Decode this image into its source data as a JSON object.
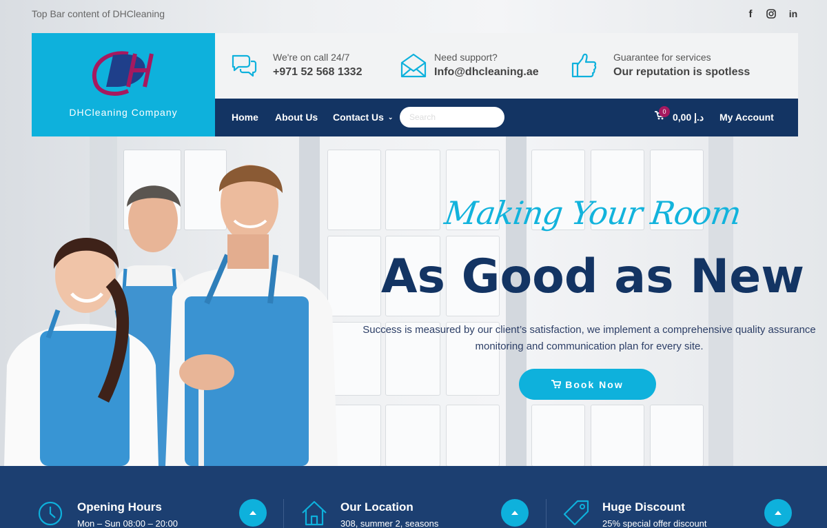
{
  "topbar": {
    "text": "Top Bar content of DHCleaning",
    "social": [
      {
        "icon": "facebook-icon",
        "glyph": "f"
      },
      {
        "icon": "instagram-icon",
        "glyph": "◎"
      },
      {
        "icon": "linkedin-icon",
        "glyph": "in"
      }
    ]
  },
  "logo": {
    "caption": "DHCleaning Company",
    "letters": "DH"
  },
  "info": [
    {
      "icon": "chat-bubbles-icon",
      "label": "We're on call 24/7",
      "value": "+971 52 568 1332"
    },
    {
      "icon": "envelope-icon",
      "label": "Need support?",
      "value": "Info@dhcleaning.ae"
    },
    {
      "icon": "thumbs-up-icon",
      "label": "Guarantee for services",
      "value": "Our reputation is spotless"
    }
  ],
  "nav": {
    "home": "Home",
    "about": "About Us",
    "contact": "Contact Us",
    "search_placeholder": "Search",
    "cart_count": "0",
    "cart_amount": "د.إ 0,00",
    "account": "My Account"
  },
  "hero": {
    "script": "Making Your Room",
    "title": "As Good as New",
    "description": "Success is measured by our client’s satisfaction, we implement a comprehensive quality assurance monitoring and communication plan for every site.",
    "button": "Book Now"
  },
  "features": [
    {
      "icon": "clock-icon",
      "title": "Opening Hours",
      "sub": "Mon – Sun 08:00 – 20:00"
    },
    {
      "icon": "home-icon",
      "title": "Our Location",
      "sub": "308, summer 2, seasons"
    },
    {
      "icon": "tag-icon",
      "title": "Huge Discount",
      "sub": "25% special offer discount"
    }
  ],
  "colors": {
    "accent": "#0eb1dc",
    "navy": "#133463",
    "logo_pink": "#a6195f"
  }
}
